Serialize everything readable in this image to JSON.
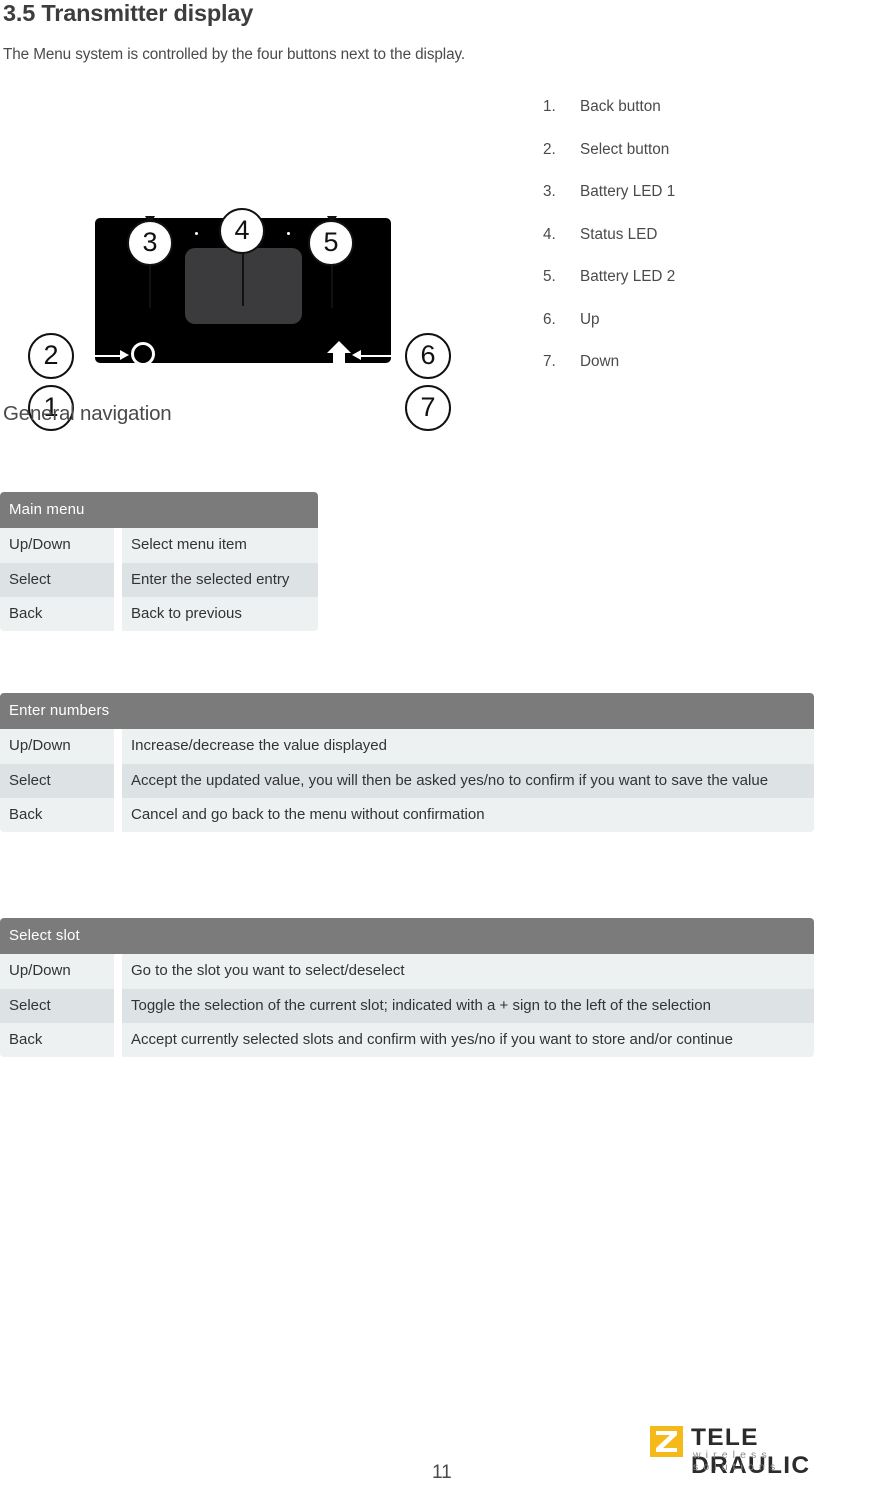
{
  "document": {
    "title": "3.5 Transmitter display",
    "intro": "The Menu system is controlled by the four buttons next to the display.",
    "section_heading": "General navigation",
    "page_number": "11"
  },
  "figure": {
    "name": "transmitter-display-diagram",
    "callouts": [
      "1",
      "2",
      "3",
      "4",
      "5",
      "6",
      "7"
    ],
    "screen_color": "#3b3b3d",
    "body_color": "#000000",
    "led_color": "#ffffff",
    "arrow_up": "↑",
    "arrow_down": "↓"
  },
  "legend": {
    "items": [
      {
        "index": "1.",
        "label": "Back button"
      },
      {
        "index": "2.",
        "label": "Select button"
      },
      {
        "index": "3.",
        "label": "Battery LED 1"
      },
      {
        "index": "4.",
        "label": "Status LED"
      },
      {
        "index": "5.",
        "label": "Battery LED 2"
      },
      {
        "index": "6.",
        "label": "Up"
      },
      {
        "index": "7.",
        "label": "Down"
      }
    ]
  },
  "tables": [
    {
      "id": "main-menu",
      "header": "Main menu",
      "rows": [
        {
          "key": "Up/Down",
          "value": "Select menu item"
        },
        {
          "key": "Select",
          "value": "Enter the selected entry"
        },
        {
          "key": "Back",
          "value": "Back to previous"
        }
      ]
    },
    {
      "id": "enter-numbers",
      "header": "Enter numbers",
      "rows": [
        {
          "key": "Up/Down",
          "value": "Increase/decrease the value displayed"
        },
        {
          "key": "Select",
          "value": "Accept the updated value, you will then be asked yes/no to confirm if you want to save the value"
        },
        {
          "key": "Back",
          "value": "Cancel and go back to the menu without confirmation"
        }
      ]
    },
    {
      "id": "select-slot",
      "header": "Select slot",
      "rows": [
        {
          "key": "Up/Down",
          "value": "Go to the slot you want to select/deselect"
        },
        {
          "key": "Select",
          "value": "Toggle the selection of the current slot; indicated with a + sign to the left of the selection"
        },
        {
          "key": "Back",
          "value": "Accept currently selected slots and confirm with yes/no if you want to store and/or continue"
        }
      ]
    }
  ],
  "footer": {
    "brand": "TELE DRAULIC",
    "tagline": "wireless solutions",
    "brand_color": "#f5ba1a"
  },
  "theme": {
    "table_header_bg": "#7b7b7b",
    "row_odd_bg": "#edf1f1",
    "row_even_bg": "#dde3e5",
    "text_color": "#3f3f3f"
  }
}
